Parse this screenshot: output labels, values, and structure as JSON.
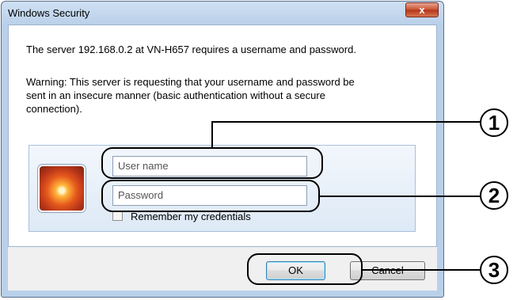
{
  "window": {
    "title": "Windows Security",
    "close_label": "x"
  },
  "message": {
    "server_line": "The server 192.168.0.2 at VN-H657 requires a username and password.",
    "warning_1": "Warning: This server is requesting that your username and password be",
    "warning_2": "sent in an insecure manner (basic authentication without a secure",
    "warning_3": "connection)."
  },
  "credentials": {
    "username_placeholder": "User name",
    "password_placeholder": "Password",
    "remember_label": "Remember my credentials",
    "remember_checked": false
  },
  "buttons": {
    "ok": "OK",
    "cancel": "Cancel"
  },
  "callouts": [
    "1",
    "2",
    "3"
  ]
}
